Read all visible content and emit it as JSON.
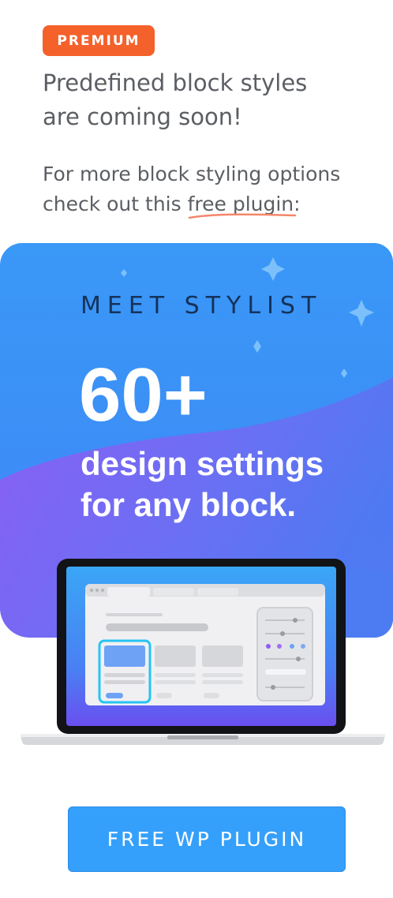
{
  "badge": {
    "label": "PREMIUM"
  },
  "headline": {
    "line1": "Predefined block styles",
    "line2": "are coming soon!"
  },
  "subline": {
    "line1": "For more block styling options",
    "line2_prefix": "check out this ",
    "link_text": "free plugin",
    "line2_suffix": ":"
  },
  "promo": {
    "eyebrow": "MEET STYLIST",
    "big_number": "60+",
    "tagline_line1": "design settings",
    "tagline_line2": "for any block."
  },
  "cta": {
    "label": "FREE WP PLUGIN"
  },
  "colors": {
    "badge": "#f4612b",
    "promo_blue": "#3a98f7",
    "promo_purple": "#8b5cf6",
    "cta": "#35a0fb",
    "text": "#5b5e63"
  }
}
